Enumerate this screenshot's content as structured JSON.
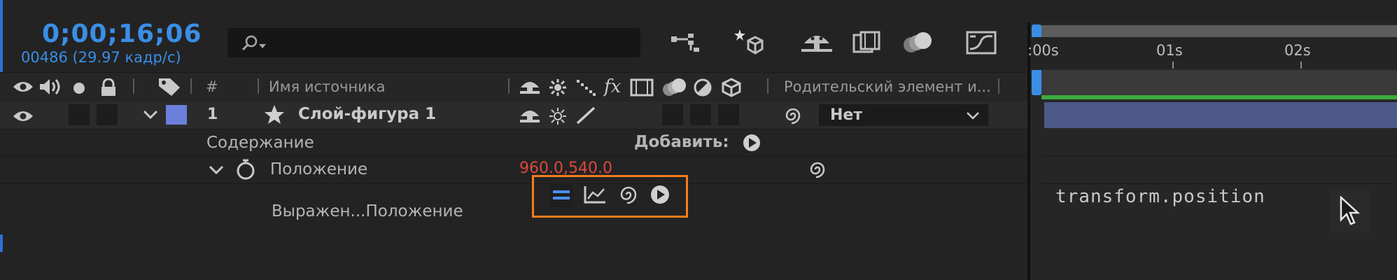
{
  "header": {
    "timecode": "0;00;16;06",
    "frame_info": "00486 (29.97 кадр/с)",
    "search_placeholder": ""
  },
  "columns": {
    "number_hash": "#",
    "source_name": "Имя источника",
    "parent": "Родительский элемент и..."
  },
  "layer": {
    "number": "1",
    "name": "Слой-фигура 1",
    "color": "#6b7fdc",
    "parent_value": "Нет"
  },
  "contents": {
    "label": "Содержание",
    "add_label": "Добавить:"
  },
  "position": {
    "label": "Положение",
    "value": "960.0,540.0",
    "value_color": "#d94a3d"
  },
  "expression": {
    "label": "Выражен...Положение",
    "code": "transform.position"
  },
  "timeline": {
    "labels": [
      ":00s",
      "01s",
      "02s"
    ]
  },
  "colors": {
    "accent_blue": "#3a8ee6",
    "highlight_orange": "#f47c1d",
    "layer_bar": "#4d5a8a",
    "work_area_green": "#3cab3c"
  }
}
